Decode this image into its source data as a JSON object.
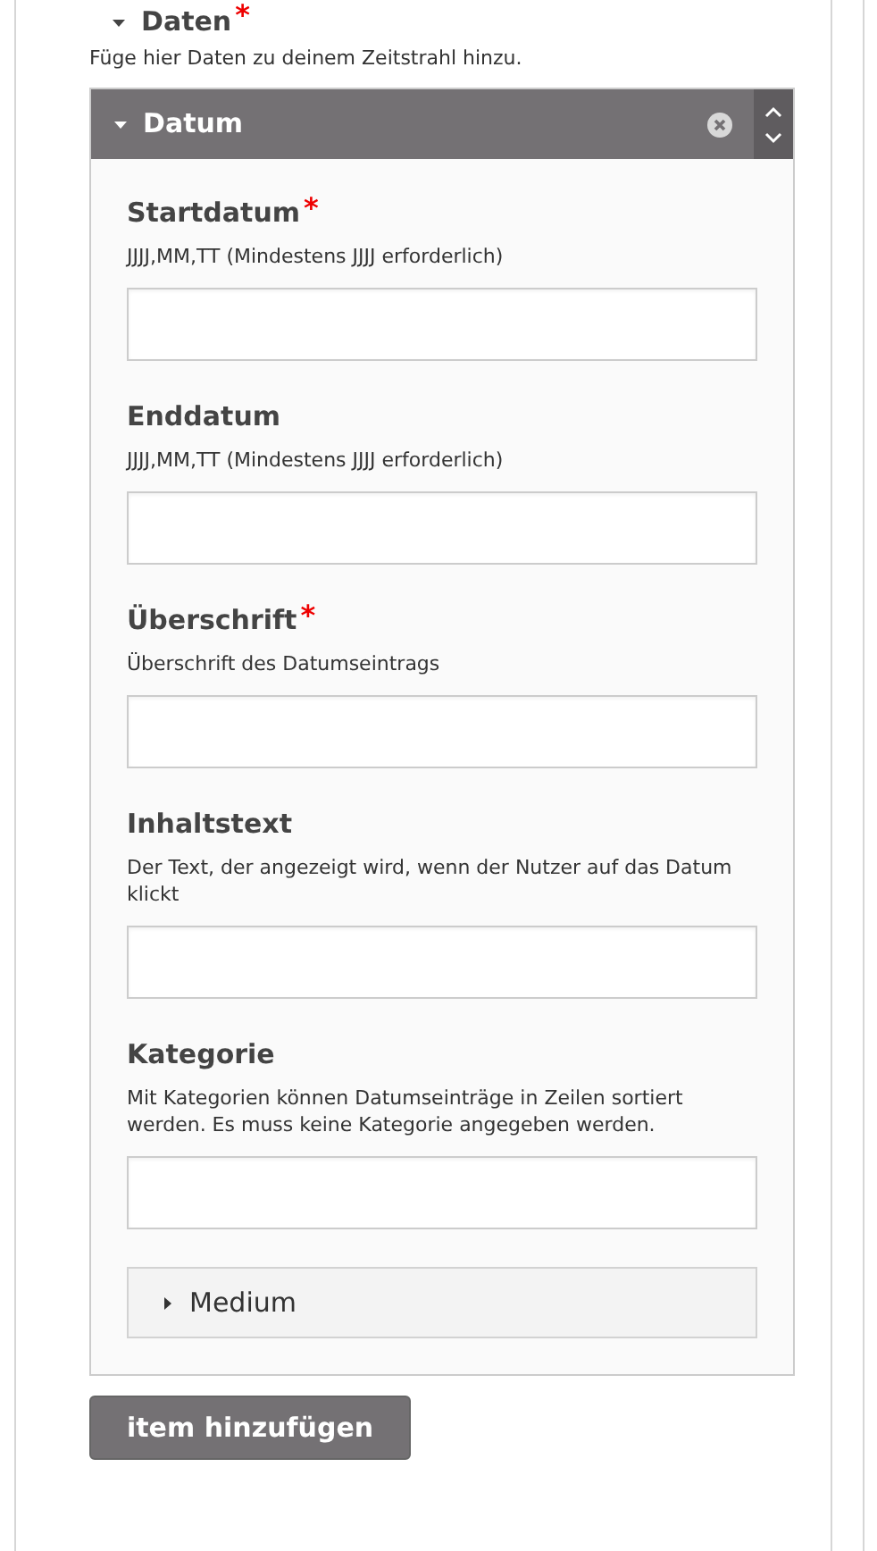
{
  "section": {
    "title": "Daten",
    "required_mark": "*",
    "expanded": true,
    "description": "Füge hier Daten zu deinem Zeitstrahl hinzu."
  },
  "item": {
    "title": "Datum",
    "expanded": true,
    "fields": [
      {
        "kind": "text",
        "label": "Startdatum",
        "required_mark": "*",
        "description": "JJJJ,MM,TT (Mindestens JJJJ erforderlich)"
      },
      {
        "kind": "text",
        "label": "Enddatum",
        "description": "JJJJ,MM,TT (Mindestens JJJJ erforderlich)"
      },
      {
        "kind": "text",
        "label": "Überschrift",
        "required_mark": "*",
        "description": "Überschrift des Datumseintrags"
      },
      {
        "kind": "text",
        "label": "Inhaltstext",
        "description": "Der Text, der angezeigt wird, wenn der Nutzer auf das Datum klickt"
      },
      {
        "kind": "text",
        "label": "Kategorie",
        "description": "Mit Kategorien können Datumseinträge in Zeilen sortiert werden. Es muss keine Kategorie angegeben werden."
      },
      {
        "kind": "group",
        "label": "Medium",
        "expanded": false
      }
    ]
  },
  "add_button": "item hinzufügen"
}
